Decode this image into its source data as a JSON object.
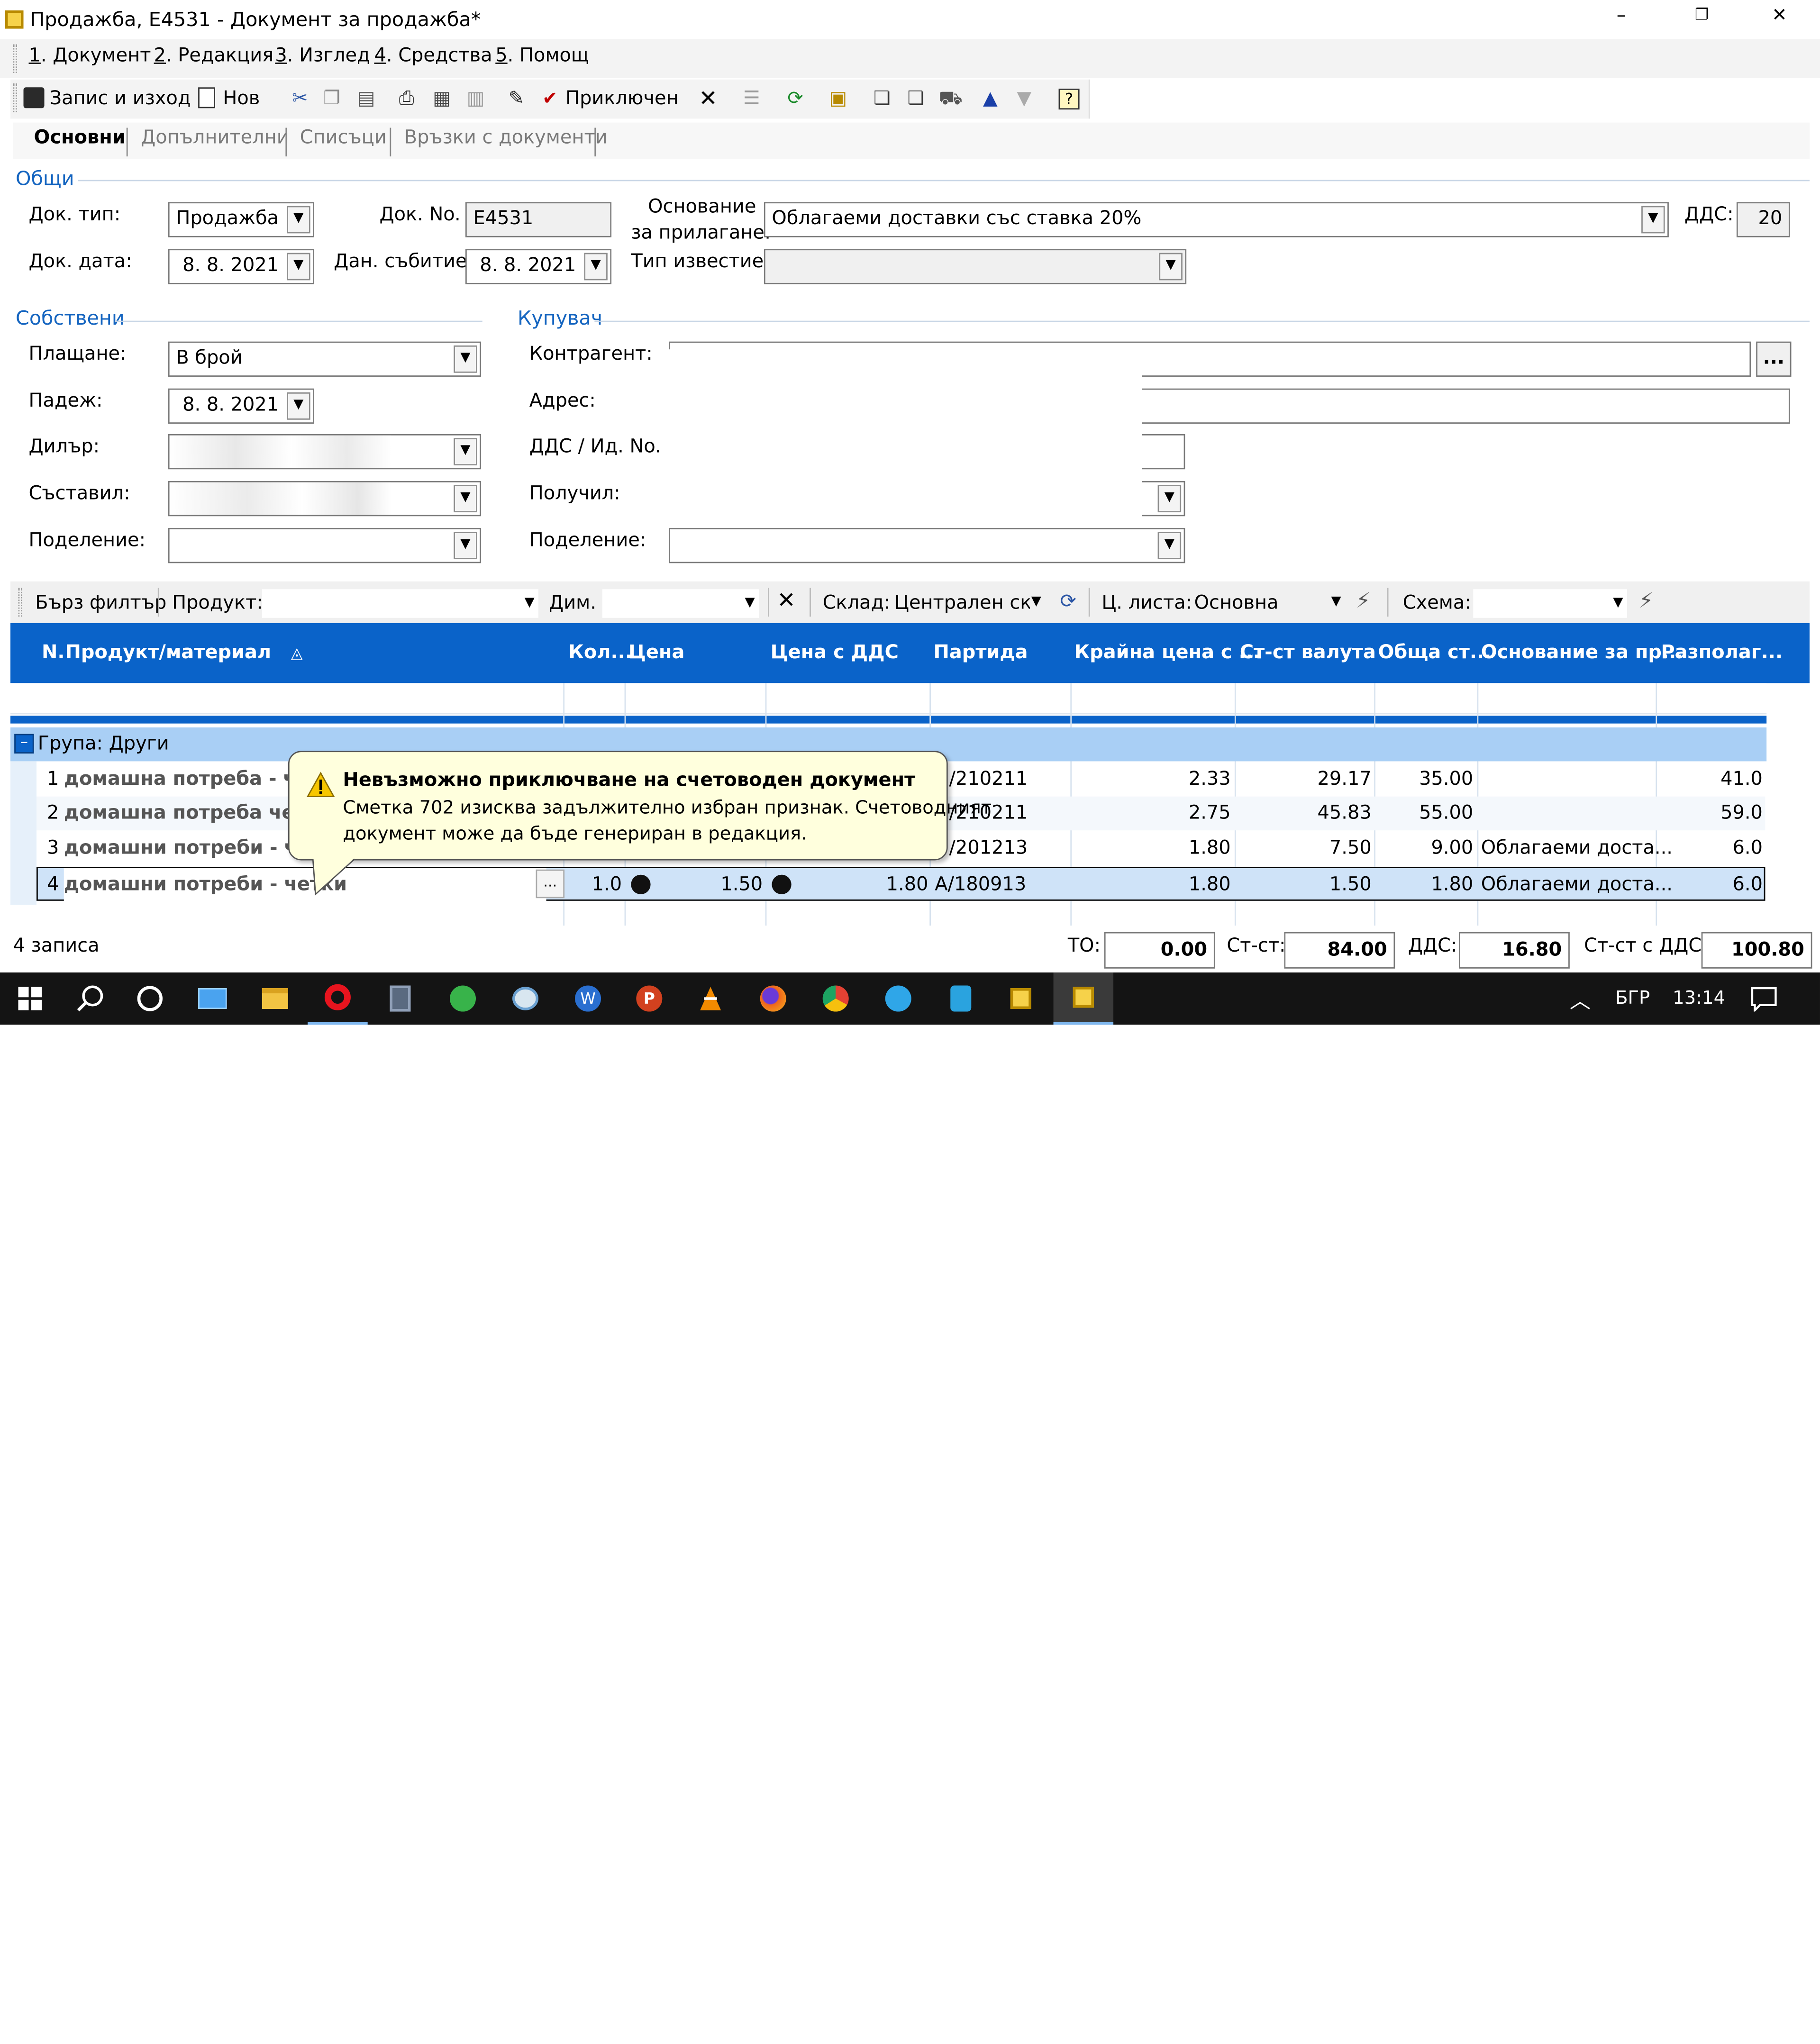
{
  "window": {
    "title": "Продажба, Е4531 - Документ за продажба*",
    "min_glyph": "–",
    "restore_glyph": "❐",
    "close_glyph": "✕"
  },
  "menu": [
    {
      "num": "1",
      "text": ". Документ"
    },
    {
      "num": "2",
      "text": ". Редакция"
    },
    {
      "num": "3",
      "text": ". Изглед"
    },
    {
      "num": "4",
      "text": ". Средства"
    },
    {
      "num": "5",
      "text": ". Помощ"
    }
  ],
  "toolbar": {
    "save_exit": "Запис и изход",
    "new": "Нов",
    "finished": "Приключен"
  },
  "tabs": [
    "Основни",
    "Допълнителни",
    "Списъци",
    "Връзки с документи"
  ],
  "general": {
    "section": "Общи",
    "doc_type_label": "Док. тип:",
    "doc_type_value": "Продажба",
    "doc_no_label": "Док. No.",
    "doc_no_value": "Е4531",
    "basis_label_1": "Основание",
    "basis_label_2": "за прилагане:",
    "basis_value": "Облагаеми доставки със ставка 20%",
    "vat_label": "ДДС:",
    "vat_value": "20",
    "doc_date_label": "Док. дата:",
    "doc_date_value": "8.  8. 2021",
    "tax_event_label": "Дан. събитие:",
    "tax_event_value": "8.  8. 2021",
    "notice_type_label": "Тип известие:",
    "notice_type_value": ""
  },
  "own": {
    "section": "Собствени",
    "payment_label": "Плащане:",
    "payment_value": "В брой",
    "due_label": "Падеж:",
    "due_value": "8.  8. 2021",
    "dealer_label": "Дилър:",
    "composer_label": "Съставил:",
    "division_label": "Поделение:"
  },
  "buyer": {
    "section": "Купувач",
    "contractor_label": "Контрагент:",
    "browse": "...",
    "address_label": "Адрес:",
    "vat_id_label": "ДДС / Ид. No.",
    "received_label": "Получил:",
    "division_label": "Поделение:"
  },
  "filter": {
    "quick": "Бърз филтър",
    "product": "Продукт:",
    "dim": "Дим.",
    "warehouse_label": "Склад:",
    "warehouse_value": "Централен скл",
    "pricelist_label": "Ц. листа:",
    "pricelist_value": "Основна",
    "scheme_label": "Схема:"
  },
  "grid": {
    "columns": [
      "N.",
      "Продукт/материал",
      "Кол...",
      "Цена",
      "Цена с ДДС",
      "Партида",
      "Крайна цена с ...",
      "Ст-ст валута",
      "Обща ст...",
      "Основание за пр...",
      "Разполаг..."
    ],
    "sort_glyph": "◬",
    "group_toggle": "–",
    "group_label": "Група: Други",
    "rows": [
      {
        "n": "1",
        "product": "домашна потреба - четки",
        "qty": "",
        "price": "",
        "price_vat": "",
        "batch": "/210211",
        "final": "2.33",
        "cost": "29.17",
        "total": "35.00",
        "basis": "",
        "avail": "41.0"
      },
      {
        "n": "2",
        "product": "домашна потреба четка",
        "qty": "",
        "price": "",
        "price_vat": "",
        "batch": "/210211",
        "final": "2.75",
        "cost": "45.83",
        "total": "55.00",
        "basis": "",
        "avail": "59.0"
      },
      {
        "n": "3",
        "product": "домашни потреби - четки",
        "qty": "",
        "price": "",
        "price_vat": "",
        "batch": "/201213",
        "final": "1.80",
        "cost": "7.50",
        "total": "9.00",
        "basis": "Облагаеми доста...",
        "avail": "6.0"
      },
      {
        "n": "4",
        "product": "домашни потреби - четки",
        "qty": "1.0",
        "price": "1.50",
        "price_vat": "1.80",
        "batch": "А/180913",
        "final": "1.80",
        "cost": "1.50",
        "total": "1.80",
        "basis": "Облагаеми доста...",
        "avail": "6.0"
      }
    ],
    "row_browse": "..."
  },
  "tooltip": {
    "title": "Невъзможно приключване на счетоводен документ",
    "line1": "Сметка 702 изисква задължително избран признак. Счетоводният",
    "line2": "документ може да бъде генериран в редакция.",
    "icon": "warning-icon"
  },
  "footer": {
    "records": "4 записа",
    "to_label": "ТО:",
    "to_value": "0.00",
    "cost_label": "Ст-ст:",
    "cost_value": "84.00",
    "vat_label": "ДДС:",
    "vat_value": "16.80",
    "cost_vat_label": "Ст-ст с ДДС:",
    "cost_vat_value": "100.80"
  },
  "taskbar": {
    "lang": "БГР",
    "time": "13:14"
  },
  "colors": {
    "header_blue": "#0a63c9",
    "group_row": "#a9cff5",
    "selected_row": "#cfe3f8",
    "tooltip_bg": "#ffffdd",
    "section_blue": "#1565c0",
    "taskbar": "#141414"
  }
}
